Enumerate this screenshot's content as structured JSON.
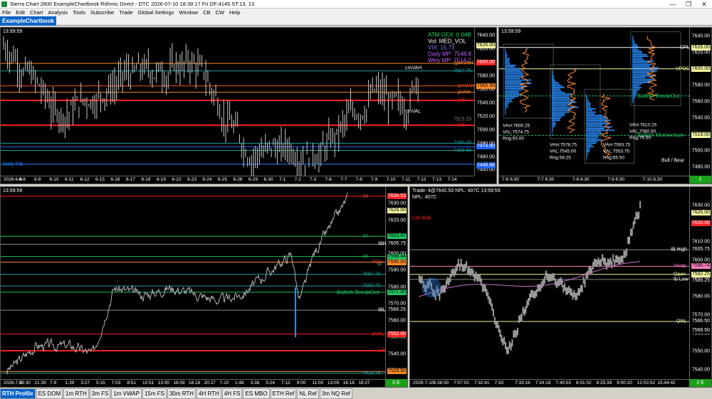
{
  "window": {
    "title": "Sierra Chart 2800 ExampleChartbook Rithmic Direct - DTC 2026-07-10  18:39:17 Fri DF:4145  ST:13, 13",
    "controls": [
      "—",
      "❐",
      "✕"
    ]
  },
  "menu": [
    "File",
    "Edit",
    "Chart",
    "Analysis",
    "Tools",
    "Subscribe",
    "Trade",
    "Global Settings",
    "Window",
    "CB",
    "CW",
    "Help"
  ],
  "chartbook_tab": "ExampleChartbook",
  "colors": {
    "background": "#000000",
    "accent_blue": "#0a64c8",
    "red_level": "#ff2020",
    "green_level": "#20c060",
    "orange_level": "#ff8a2a"
  },
  "panel_tl": {
    "time": "13:59:59",
    "info": {
      "atm_gex": "ATM GEX: 0.04B",
      "vol": "Vol: MED_VOL",
      "vix": "VIX: 15.73",
      "daily_mp": "Daily MP: 7548.8",
      "wkly_mp": "Wkly MP: 7514.2"
    },
    "y_ticks": [
      "7640.00",
      "7620.00",
      "7600.00",
      "7580.00",
      "7560.00",
      "7540.00",
      "7520.00",
      "7500.00",
      "7480.00",
      "7460.00",
      "7440.00"
    ],
    "x_ticks": [
      "2026-6-4",
      "6-8",
      "6-9",
      "6-10",
      "6-11",
      "6-12",
      "6-15",
      "6-16",
      "6-17",
      "6-18",
      "6-19",
      "6-22",
      "6-23",
      "6-24",
      "6-25",
      "6-26",
      "6-29",
      "6-30",
      "7-1",
      "7-2",
      "7-3",
      "7-6",
      "7-7",
      "7-8",
      "7-9",
      "7-10",
      "7-11",
      "7-12",
      "7-13",
      "7-14"
    ],
    "tags": [
      {
        "text": "7626.00",
        "bg": "#f5f5a0",
        "fg": "#000",
        "price": 7626
      },
      {
        "text": "7600.00",
        "bg": "#ff2020",
        "fg": "#fff",
        "price": 7600
      },
      {
        "text": "7565.50",
        "bg": "#ff8a2a",
        "fg": "#000",
        "price": 7565.5
      },
      {
        "text": "7474.90",
        "bg": "#2060ff",
        "fg": "#fff",
        "price": 7474.9
      },
      {
        "text": "7449.00",
        "bg": "#000",
        "fg": "#20a0ff",
        "price": 7449
      },
      {
        "text": "7448.88",
        "bg": "#2060ff",
        "fg": "#fff",
        "price": 7446.5
      }
    ],
    "labels": [
      {
        "text": "2pmVAH",
        "color": "#ff8a2a",
        "price": 7599
      },
      {
        "text": "cmVAH",
        "color": "#ffffff",
        "price": 7592
      },
      {
        "text": "7587.75",
        "color": "#20a0a0",
        "price": 7587.75
      },
      {
        "text": "pmVAH",
        "color": "#ff5020",
        "price": 7565.5
      },
      {
        "text": "pVAH",
        "color": "#ff8a2a",
        "price": 7556
      },
      {
        "text": "LIS",
        "color": "#ff2020",
        "price": 7544
      },
      {
        "text": "cmVAL",
        "color": "#ffffff",
        "price": 7527
      },
      {
        "text": "7515.25",
        "color": "#808080",
        "price": 7515.25
      },
      {
        "text": "LIS",
        "color": "#ff2020",
        "price": 7507
      },
      {
        "text": "7480.25",
        "color": "#20a0a0",
        "price": 7480.25
      },
      {
        "text": "7469.50",
        "color": "#20a0a0",
        "price": 7469.5
      },
      {
        "text": "Daily Flip",
        "color": "#2080ff",
        "price": 7449
      }
    ]
  },
  "panel_tr": {
    "time": "13:59:59",
    "y_ticks": [
      "7640.00",
      "7620.00",
      "7600.00",
      "7580.00",
      "7560.00",
      "7540.00",
      "7520.00",
      "7500.00",
      "7480.00"
    ],
    "x_ticks": [
      "7-6  6:30",
      "7-7  6:30",
      "7-8  6:30",
      "7-9  6:30",
      "7-10  6:30"
    ],
    "tags": [
      {
        "text": "7626.00",
        "bg": "#f5f5a0",
        "fg": "#000",
        "price": 7626
      },
      {
        "text": "7600.00",
        "bg": "#f5f5a0",
        "fg": "#000",
        "price": 7600
      },
      {
        "text": "7519.00",
        "bg": "#f5f5a0",
        "fg": "#000",
        "price": 7519
      }
    ],
    "labels": [
      {
        "text": "CPL",
        "color": "#ffffff",
        "price": 7626
      },
      {
        "text": "VPOC",
        "color": "#f5f5a0",
        "price": 7600
      },
      {
        "text": "Bullish BreakOut",
        "color": "#20c060",
        "price": 7567
      },
      {
        "text": "Bullish Momentum",
        "color": "#20c060",
        "price": 7519
      },
      {
        "text": "Bull / Bear",
        "color": "#ffffff",
        "price": 7488
      }
    ],
    "stats": [
      {
        "lines": [
          "VAH:7600.25",
          "VAL:7574.75",
          "Rng:50.00"
        ]
      },
      {
        "lines": [
          "VAH:7578.75",
          "VAL:7545.00",
          "Rng:58.25"
        ]
      },
      {
        "lines": [
          "VAH:7593.75",
          "VAL:7553.75",
          "Rng:65.50"
        ]
      },
      {
        "lines": [
          "VAH:7610.25",
          "VAL:7580.50",
          "Rng:76.50"
        ]
      }
    ],
    "corner": "2"
  },
  "panel_bl": {
    "time": "13:59:59",
    "y_ticks": [
      "7630.00",
      "7620.00",
      "7610.00",
      "7600.00",
      "7590.00",
      "7580.00",
      "7570.00",
      "7560.00",
      "7550.00",
      "7540.00",
      "7530.00"
    ],
    "x_ticks": [
      "2026-7-8",
      "19:30",
      "21:39",
      "7-9",
      "1:39",
      "3:27",
      "5:15",
      "7:03",
      "8:51",
      "10:51",
      "13:00",
      "16:09",
      "18:18",
      "20:27",
      "7-10",
      "1:48",
      "3:36",
      "5:24",
      "7:12",
      "9:00",
      "11:00",
      "13:09",
      "16:18",
      "18:27"
    ],
    "tags": [
      {
        "text": "7634.53",
        "bg": "#ff2020",
        "fg": "#fff",
        "price": 7634.5
      },
      {
        "text": "7626.00",
        "bg": "#f5f5a0",
        "fg": "#000",
        "price": 7626
      },
      {
        "text": "7610.47",
        "bg": "#20c060",
        "fg": "#000",
        "price": 7610.5
      },
      {
        "text": "7605.75",
        "bg": "#000",
        "fg": "#fff",
        "price": 7605.75
      },
      {
        "text": "7598.44",
        "bg": "#20c060",
        "fg": "#000",
        "price": 7598.4
      },
      {
        "text": "7595.00",
        "bg": "#ff8a2a",
        "fg": "#000",
        "price": 7595
      },
      {
        "text": "7577.00",
        "bg": "#20c060",
        "fg": "#000",
        "price": 7577
      },
      {
        "text": "7566.25",
        "bg": "#000",
        "fg": "#fff",
        "price": 7566.25
      },
      {
        "text": "7552.00",
        "bg": "#ff2020",
        "fg": "#fff",
        "price": 7552
      },
      {
        "text": "7529.50",
        "bg": "#ff8a2a",
        "fg": "#000",
        "price": 7529.5
      }
    ],
    "labels": [
      {
        "text": "1σ",
        "color": "#ff4040",
        "price": 7634.5
      },
      {
        "text": "1σ",
        "color": "#20c060",
        "price": 7610.5
      },
      {
        "text": "IBH",
        "color": "#ffffff",
        "price": 7605.75
      },
      {
        "text": "2σ",
        "color": "#20c060",
        "price": 7598.4
      },
      {
        "text": "PDH",
        "color": "#ff4040",
        "price": 7595
      },
      {
        "text": "P",
        "color": "#20c060",
        "price": 7593
      },
      {
        "text": "7587.75",
        "color": "#20a0a0",
        "price": 7587.75
      },
      {
        "text": "7580.75",
        "color": "#20a0a0",
        "price": 7580.75
      },
      {
        "text": "Bullish BreakOut",
        "color": "#20c060",
        "price": 7577
      },
      {
        "text": "IBL",
        "color": "#ffffff",
        "price": 7566.25
      },
      {
        "text": "pVAL",
        "color": "#ff2020",
        "price": 7552
      },
      {
        "text": "LIS",
        "color": "#ff2020",
        "price": 7542
      },
      {
        "text": "7529.75",
        "color": "#20a0a0",
        "price": 7528.5
      }
    ],
    "corner": "0 E"
  },
  "panel_br": {
    "header": "Trade: 4@7642.50  NPL: 407C 13:59:59",
    "sub": "NPL: 407C",
    "y_ticks": [
      "7630.00",
      "7620.00",
      "7610.00",
      "7600.00",
      "7590.00",
      "7580.00",
      "7570.00",
      "7560.00",
      "7550.00",
      "7540.00"
    ],
    "x_ticks": [
      "2026-7-10",
      "6:36:50",
      "7:07:02",
      "7:32:41",
      "7:33",
      "7:33:16",
      "7:34:18",
      "7:40:55",
      "8:01:02",
      "8:25:39",
      "9:00:20",
      "12:03:52",
      "15:44:42"
    ],
    "tags": [
      {
        "text": "7626.00",
        "bg": "#f5f5a0",
        "fg": "#000",
        "price": 7626
      },
      {
        "text": "7620.00",
        "bg": "#ff2020",
        "fg": "#fff",
        "price": 7620
      },
      {
        "text": "7605.75",
        "bg": "#000",
        "fg": "#fff",
        "price": 7605.75
      },
      {
        "text": "7596.74",
        "bg": "#ff80c0",
        "fg": "#000",
        "price": 7596.7
      },
      {
        "text": "7592.25",
        "bg": "#f5f5a0",
        "fg": "#000",
        "price": 7592.25
      },
      {
        "text": "7586.25",
        "bg": "#000",
        "fg": "#fff",
        "price": 7588.5
      },
      {
        "text": "7566.50",
        "bg": "#000",
        "fg": "#fff",
        "price": 7566.5
      },
      {
        "text": "7568.50",
        "bg": "#000",
        "fg": "#fff",
        "price": 7561.5
      }
    ],
    "labels": [
      {
        "text": "Call Wall",
        "color": "#ff2020",
        "price": 7623
      },
      {
        "text": "IB High",
        "color": "#ffffff",
        "price": 7605.75
      },
      {
        "text": "Vwap",
        "color": "#ff80c0",
        "price": 7596.7
      },
      {
        "text": "Open",
        "color": "#f5f5a0",
        "price": 7592.25
      },
      {
        "text": "Ib Low",
        "color": "#ffffff",
        "price": 7589.5
      },
      {
        "text": "ONL",
        "color": "#f5f5a0",
        "price": 7566.5
      }
    ],
    "corner": "2 E"
  },
  "bottom_tabs": [
    "RTH Profile",
    "ES DOM",
    "1m RTH",
    "3m FS",
    "1m VWAP",
    "15m FS",
    "30m RTH",
    "4H RTH",
    "4H FS",
    "ES MBO",
    "ETH Ref",
    "NL Ref",
    "3m NQ Ref"
  ],
  "active_tab": "RTH Profile"
}
